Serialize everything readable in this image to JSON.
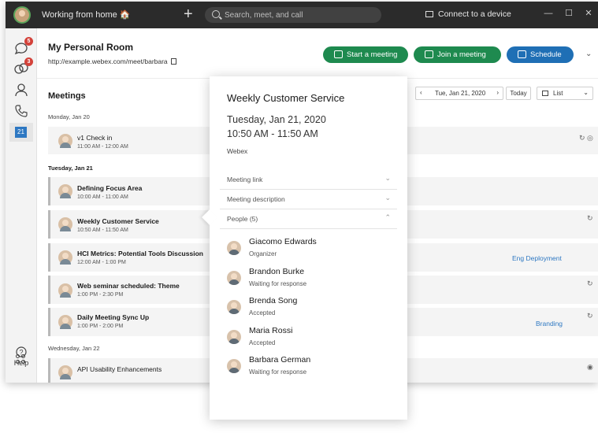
{
  "titlebar": {
    "status": "Working from home 🏠",
    "search_placeholder": "Search, meet, and call",
    "connect": "Connect to a device",
    "minimize": "—",
    "maximize": "☐",
    "close": "✕"
  },
  "rail": {
    "messaging_badge": "5",
    "teams_badge": "3",
    "calendar_day": "21",
    "help_label": "Help"
  },
  "header": {
    "room_title": "My Personal Room",
    "room_url": "http://example.webex.com/meet/barbara",
    "start_meeting": "Start a meeting",
    "join_meeting": "Join a meeting",
    "schedule": "Schedule"
  },
  "meetings": {
    "title": "Meetings",
    "date_display": "Tue, Jan 21, 2020",
    "today_label": "Today",
    "view_select": "List",
    "days": [
      {
        "label": "Monday, Jan 20"
      },
      {
        "label": "Tuesday, Jan 21"
      },
      {
        "label": "Wednesday, Jan 22"
      }
    ],
    "rows": [
      {
        "title": "v1 Check in",
        "time": "11:00 AM - 12:00 AM",
        "tag": ""
      },
      {
        "title": "Defining Focus Area",
        "time": "10:00 AM - 11:00 AM",
        "tag": ""
      },
      {
        "title": "Weekly Customer Service",
        "time": "10:50 AM - 11:50 AM",
        "tag": ""
      },
      {
        "title": "HCI Metrics: Potential Tools Discussion",
        "time": "12:00 AM - 1:00 PM",
        "tag": "Eng Deployment"
      },
      {
        "title": "Web seminar scheduled: Theme",
        "time": "1:00 PM - 2:30 PM",
        "tag": ""
      },
      {
        "title": "Daily Meeting Sync Up",
        "time": "1:00 PM - 2:00 PM",
        "tag": "Branding"
      },
      {
        "title": "API Usability Enhancements",
        "time": "",
        "tag": ""
      }
    ]
  },
  "popover": {
    "title": "Weekly Customer Service",
    "date": "Tuesday, Jan 21, 2020",
    "time": "10:50 AM - 11:50 AM",
    "provider": "Webex",
    "sections": {
      "meeting_link": "Meeting link",
      "meeting_description": "Meeting description",
      "people": "People (5)"
    },
    "people": [
      {
        "name": "Giacomo Edwards",
        "status": "Organizer"
      },
      {
        "name": "Brandon Burke",
        "status": "Waiting for response"
      },
      {
        "name": "Brenda Song",
        "status": "Accepted"
      },
      {
        "name": "Maria Rossi",
        "status": "Accepted"
      },
      {
        "name": "Barbara German",
        "status": "Waiting for response"
      }
    ]
  }
}
